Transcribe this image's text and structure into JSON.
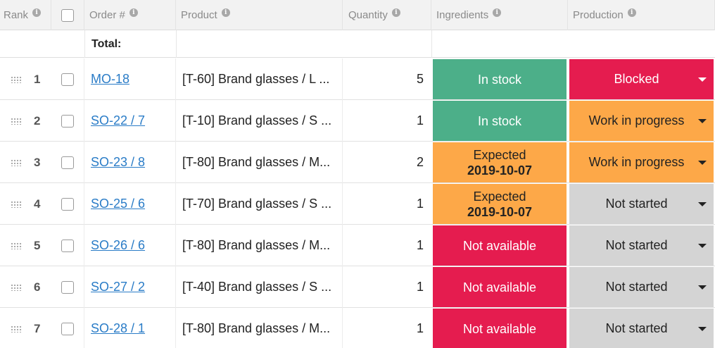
{
  "header": {
    "rank": "Rank",
    "order": "Order #",
    "product": "Product",
    "quantity": "Quantity",
    "ingredients": "Ingredients",
    "production": "Production",
    "info_icon": "info-icon"
  },
  "total_label": "Total:",
  "status_colors": {
    "in_stock": "#4caf89",
    "expected": "#fda848",
    "not_available": "#e51c4f",
    "blocked": "#e51c4f",
    "work_in_progress": "#fda848",
    "not_started": "#d4d4d4",
    "link": "#2a7cc7"
  },
  "rows": [
    {
      "rank": "1",
      "order": "MO-18",
      "product": "[T-60] Brand glasses / L ...",
      "quantity": "5",
      "ingredients": {
        "status": "In stock",
        "date": ""
      },
      "production": "Blocked"
    },
    {
      "rank": "2",
      "order": "SO-22 / 7",
      "product": "[T-10] Brand glasses / S ...",
      "quantity": "1",
      "ingredients": {
        "status": "In stock",
        "date": ""
      },
      "production": "Work in progress"
    },
    {
      "rank": "3",
      "order": "SO-23 / 8",
      "product": "[T-80] Brand glasses / M...",
      "quantity": "2",
      "ingredients": {
        "status": "Expected",
        "date": "2019-10-07"
      },
      "production": "Work in progress"
    },
    {
      "rank": "4",
      "order": "SO-25 / 6",
      "product": "[T-70] Brand glasses / S ...",
      "quantity": "1",
      "ingredients": {
        "status": "Expected",
        "date": "2019-10-07"
      },
      "production": "Not started"
    },
    {
      "rank": "5",
      "order": "SO-26 / 6",
      "product": "[T-80] Brand glasses / M...",
      "quantity": "1",
      "ingredients": {
        "status": "Not available",
        "date": ""
      },
      "production": "Not started"
    },
    {
      "rank": "6",
      "order": "SO-27 / 2",
      "product": "[T-40] Brand glasses / S ...",
      "quantity": "1",
      "ingredients": {
        "status": "Not available",
        "date": ""
      },
      "production": "Not started"
    },
    {
      "rank": "7",
      "order": "SO-28 / 1",
      "product": "[T-80] Brand glasses / M...",
      "quantity": "1",
      "ingredients": {
        "status": "Not available",
        "date": ""
      },
      "production": "Not started"
    }
  ]
}
